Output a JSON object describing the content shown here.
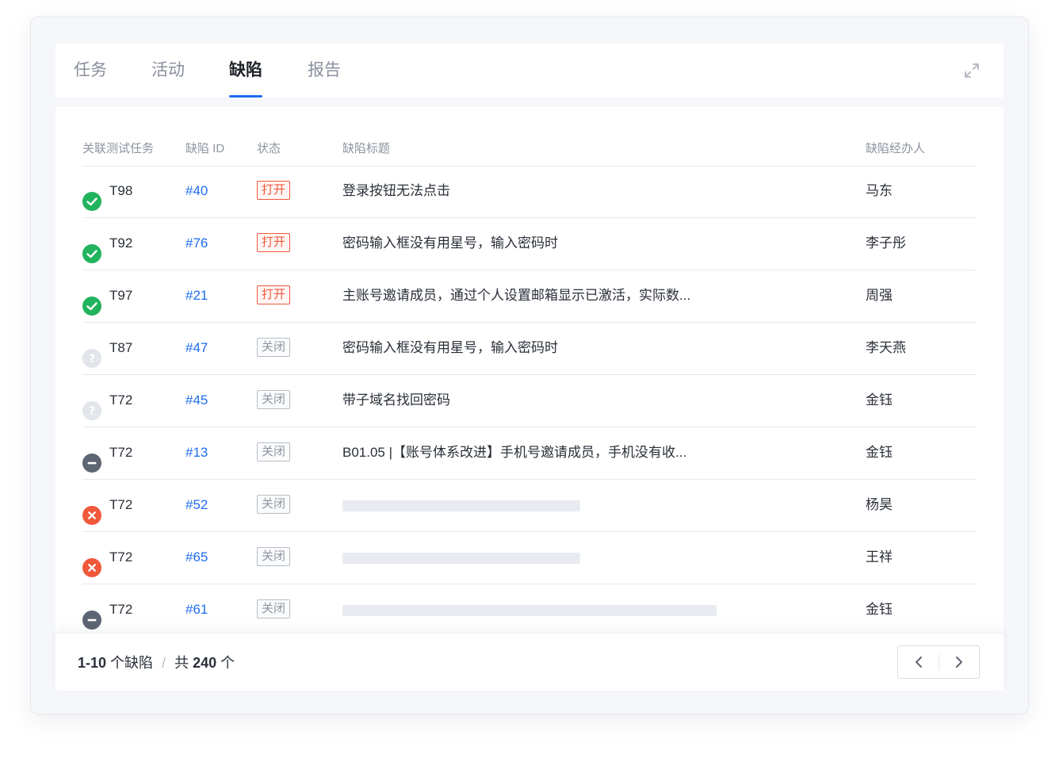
{
  "tabs": [
    {
      "label": "任务",
      "active": false
    },
    {
      "label": "活动",
      "active": false
    },
    {
      "label": "缺陷",
      "active": true
    },
    {
      "label": "报告",
      "active": false
    }
  ],
  "expand_icon": "expand-icon",
  "table": {
    "headers": {
      "task": "关联测试任务",
      "id": "缺陷 ID",
      "state": "状态",
      "title": "缺陷标题",
      "owner": "缺陷经办人"
    },
    "rows": [
      {
        "status_icon": "check-circle-icon",
        "task": "T98",
        "id": "#40",
        "state": "打开",
        "state_type": "open",
        "title": "登录按钮无法点击",
        "owner": "马东"
      },
      {
        "status_icon": "check-circle-icon",
        "task": "T92",
        "id": "#76",
        "state": "打开",
        "state_type": "open",
        "title": "密码输入框没有用星号，输入密码时",
        "owner": "李子彤"
      },
      {
        "status_icon": "check-circle-icon",
        "task": "T97",
        "id": "#21",
        "state": "打开",
        "state_type": "open",
        "title": "主账号邀请成员，通过个人设置邮箱显示已激活，实际数...",
        "owner": "周强"
      },
      {
        "status_icon": "question-circle-icon",
        "task": "T87",
        "id": "#47",
        "state": "关闭",
        "state_type": "closed",
        "title": "密码输入框没有用星号，输入密码时",
        "owner": "李天燕"
      },
      {
        "status_icon": "question-circle-icon",
        "task": "T72",
        "id": "#45",
        "state": "关闭",
        "state_type": "closed",
        "title": "带子域名找回密码",
        "owner": "金钰"
      },
      {
        "status_icon": "minus-circle-icon",
        "task": "T72",
        "id": "#13",
        "state": "关闭",
        "state_type": "closed",
        "title": "B01.05 |【账号体系改进】手机号邀请成员，手机没有收...",
        "owner": "金钰"
      },
      {
        "status_icon": "x-circle-icon",
        "task": "T72",
        "id": "#52",
        "state": "关闭",
        "state_type": "closed",
        "title": "",
        "owner": "杨昊"
      },
      {
        "status_icon": "x-circle-icon",
        "task": "T72",
        "id": "#65",
        "state": "关闭",
        "state_type": "closed",
        "title": "",
        "owner": "王祥"
      },
      {
        "status_icon": "minus-circle-icon",
        "task": "T72",
        "id": "#61",
        "state": "关闭",
        "state_type": "closed",
        "title": "",
        "owner": "金钰"
      }
    ]
  },
  "footer": {
    "range": "1-10",
    "unit": "个缺陷",
    "separator": "/",
    "total_prefix": "共",
    "total": "240",
    "total_unit": "个"
  },
  "pager": {
    "prev_icon": "chevron-left-icon",
    "next_icon": "chevron-right-icon"
  },
  "colors": {
    "accent": "#1e6cf0",
    "open": "#f0583c",
    "success": "#22b35e",
    "unknown": "#e2e5ea",
    "neutral": "#5d6472",
    "error": "#f0583c"
  }
}
